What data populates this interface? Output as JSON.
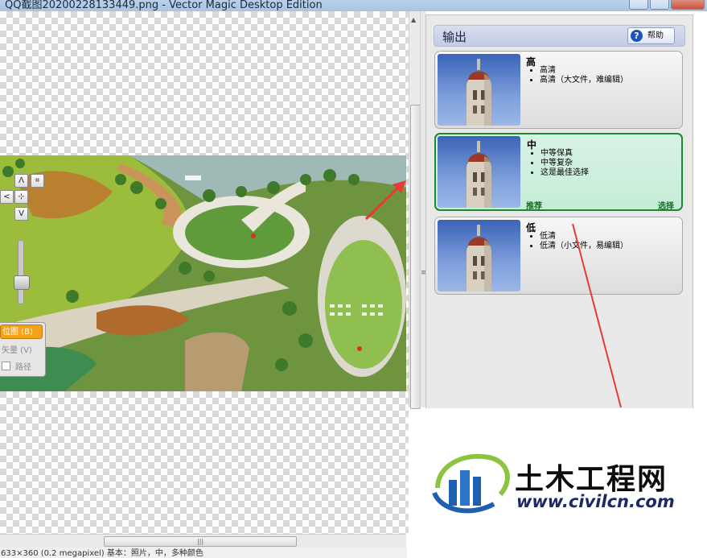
{
  "window": {
    "title": "QQ截图20200228133449.png - Vector Magic Desktop Edition"
  },
  "left_tools": {
    "up": "Λ",
    "down": "V",
    "left": "<",
    "fit": "⊹",
    "zoom_box": "⌗",
    "mode_bitmap": "位图 (B)",
    "mode_vector": "矢量 (V)",
    "mode_path": "路径"
  },
  "status_bar": {
    "text": "633×360 (0.2 megapixel)  基本：照片，中，多种颜色"
  },
  "output_panel": {
    "title": "输出",
    "help_label": "帮助",
    "options": [
      {
        "title": "高",
        "bullets": [
          "高清",
          "高清（大文件，难编辑）"
        ],
        "selected": false,
        "recommend": "",
        "choose": ""
      },
      {
        "title": "中",
        "bullets": [
          "中等保真",
          "中等复杂",
          "这是最佳选择"
        ],
        "selected": true,
        "recommend": "推荐",
        "choose": "选择"
      },
      {
        "title": "低",
        "bullets": [
          "低清",
          "低清（小文件，易编辑）"
        ],
        "selected": false,
        "recommend": "",
        "choose": ""
      }
    ]
  },
  "watermark": {
    "name": "土木工程网",
    "url": "www.civilcn.com"
  },
  "colors": {
    "selected_border": "#1a8b2f",
    "bitmap_mode": "#f4a21a",
    "arrow": "#e63a33"
  }
}
